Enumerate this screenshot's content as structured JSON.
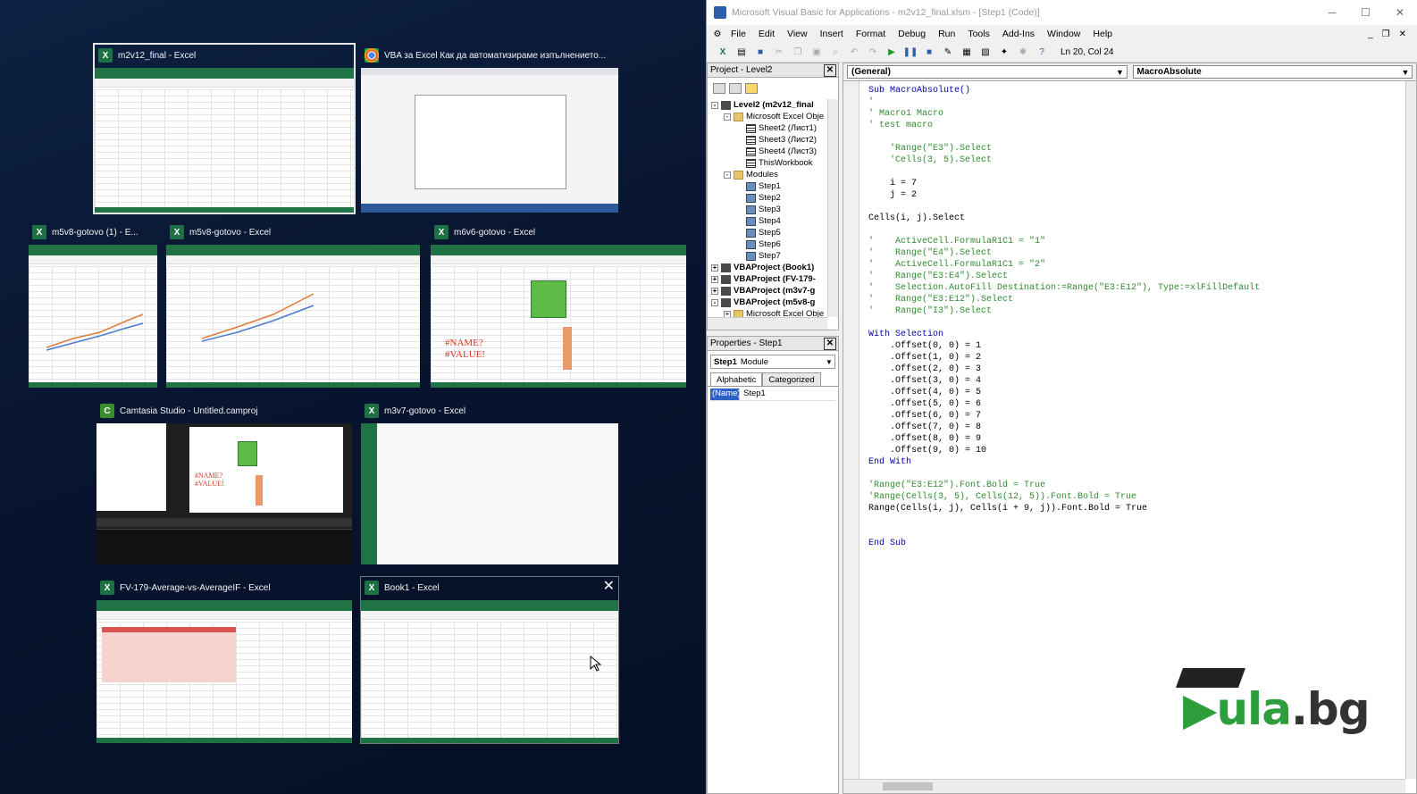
{
  "switcher": {
    "windows": [
      {
        "title": "m2v12_final - Excel",
        "icon": "excel-icon"
      },
      {
        "title": "VBA за Excel Как да автоматизираме изпълнението...",
        "icon": "chrome-icon"
      },
      {
        "title": "m5v8-gotovo (1) - E...",
        "icon": "excel-icon"
      },
      {
        "title": "m5v8-gotovo - Excel",
        "icon": "excel-icon"
      },
      {
        "title": "m6v6-gotovo - Excel",
        "icon": "excel-icon",
        "errors": [
          "#NAME?",
          "#VALUE!"
        ]
      },
      {
        "title": "Camtasia Studio - Untitled.camproj",
        "icon": "camtasia-icon",
        "errors": [
          "#NAME?",
          "#VALUE!"
        ]
      },
      {
        "title": "m3v7-gotovo - Excel",
        "icon": "excel-icon"
      },
      {
        "title": "FV-179-Average-vs-AverageIF - Excel",
        "icon": "excel-icon"
      },
      {
        "title": "Book1 - Excel",
        "icon": "excel-icon"
      }
    ]
  },
  "vbe": {
    "title": "Microsoft Visual Basic for Applications - m2v12_final.xlsm - [Step1 (Code)]",
    "menu": [
      "File",
      "Edit",
      "View",
      "Insert",
      "Format",
      "Debug",
      "Run",
      "Tools",
      "Add-Ins",
      "Window",
      "Help"
    ],
    "cursor_pos": "Ln 20, Col 24",
    "project": {
      "header": "Project - Level2",
      "tree": [
        {
          "label": "Level2 (m2v12_final",
          "level": 0,
          "kind": "proj",
          "toggle": "-",
          "bold": true
        },
        {
          "label": "Microsoft Excel Obje",
          "level": 1,
          "kind": "fold",
          "toggle": "-"
        },
        {
          "label": "Sheet2 (Лист1)",
          "level": 2,
          "kind": "sheet"
        },
        {
          "label": "Sheet3 (Лист2)",
          "level": 2,
          "kind": "sheet"
        },
        {
          "label": "Sheet4 (Лист3)",
          "level": 2,
          "kind": "sheet"
        },
        {
          "label": "ThisWorkbook",
          "level": 2,
          "kind": "sheet"
        },
        {
          "label": "Modules",
          "level": 1,
          "kind": "fold",
          "toggle": "-"
        },
        {
          "label": "Step1",
          "level": 2,
          "kind": "mod"
        },
        {
          "label": "Step2",
          "level": 2,
          "kind": "mod"
        },
        {
          "label": "Step3",
          "level": 2,
          "kind": "mod"
        },
        {
          "label": "Step4",
          "level": 2,
          "kind": "mod"
        },
        {
          "label": "Step5",
          "level": 2,
          "kind": "mod"
        },
        {
          "label": "Step6",
          "level": 2,
          "kind": "mod"
        },
        {
          "label": "Step7",
          "level": 2,
          "kind": "mod"
        },
        {
          "label": "VBAProject (Book1)",
          "level": 0,
          "kind": "proj",
          "toggle": "+",
          "bold": true
        },
        {
          "label": "VBAProject (FV-179-",
          "level": 0,
          "kind": "proj",
          "toggle": "+",
          "bold": true
        },
        {
          "label": "VBAProject (m3v7-g",
          "level": 0,
          "kind": "proj",
          "toggle": "+",
          "bold": true
        },
        {
          "label": "VBAProject (m5v8-g",
          "level": 0,
          "kind": "proj",
          "toggle": "-",
          "bold": true
        },
        {
          "label": "Microsoft Excel Obje",
          "level": 1,
          "kind": "fold",
          "toggle": "+"
        }
      ]
    },
    "properties": {
      "header": "Properties - Step1",
      "object_name": "Step1",
      "object_type": "Module",
      "tabs": [
        "Alphabetic",
        "Categorized"
      ],
      "rows": [
        {
          "key": "(Name)",
          "value": "Step1"
        }
      ]
    },
    "combo_object": "(General)",
    "combo_proc": "MacroAbsolute",
    "code_lines": [
      {
        "t": "Sub MacroAbsolute()",
        "c": "kw"
      },
      {
        "t": "'",
        "c": "cm"
      },
      {
        "t": "' Macro1 Macro",
        "c": "cm"
      },
      {
        "t": "' test macro",
        "c": "cm"
      },
      {
        "t": "",
        "c": ""
      },
      {
        "t": "    'Range(\"E3\").Select",
        "c": "cm"
      },
      {
        "t": "    'Cells(3, 5).Select",
        "c": "cm"
      },
      {
        "t": "",
        "c": ""
      },
      {
        "t": "    i = 7",
        "c": ""
      },
      {
        "t": "    j = 2",
        "c": ""
      },
      {
        "t": "",
        "c": ""
      },
      {
        "t": "Cells(i, j).Select",
        "c": ""
      },
      {
        "t": "",
        "c": ""
      },
      {
        "t": "'    ActiveCell.FormulaR1C1 = \"1\"",
        "c": "cm"
      },
      {
        "t": "'    Range(\"E4\").Select",
        "c": "cm"
      },
      {
        "t": "'    ActiveCell.FormulaR1C1 = \"2\"",
        "c": "cm"
      },
      {
        "t": "'    Range(\"E3:E4\").Select",
        "c": "cm"
      },
      {
        "t": "'    Selection.AutoFill Destination:=Range(\"E3:E12\"), Type:=xlFillDefault",
        "c": "cm"
      },
      {
        "t": "'    Range(\"E3:E12\").Select",
        "c": "cm"
      },
      {
        "t": "'    Range(\"I3\").Select",
        "c": "cm"
      },
      {
        "t": "",
        "c": ""
      },
      {
        "t": "With Selection",
        "c": "kw"
      },
      {
        "t": "    .Offset(0, 0) = 1",
        "c": ""
      },
      {
        "t": "    .Offset(1, 0) = 2",
        "c": ""
      },
      {
        "t": "    .Offset(2, 0) = 3",
        "c": ""
      },
      {
        "t": "    .Offset(3, 0) = 4",
        "c": ""
      },
      {
        "t": "    .Offset(4, 0) = 5",
        "c": ""
      },
      {
        "t": "    .Offset(5, 0) = 6",
        "c": ""
      },
      {
        "t": "    .Offset(6, 0) = 7",
        "c": ""
      },
      {
        "t": "    .Offset(7, 0) = 8",
        "c": ""
      },
      {
        "t": "    .Offset(8, 0) = 9",
        "c": ""
      },
      {
        "t": "    .Offset(9, 0) = 10",
        "c": ""
      },
      {
        "t": "End With",
        "c": "kw"
      },
      {
        "t": "",
        "c": ""
      },
      {
        "t": "'Range(\"E3:E12\").Font.Bold = True",
        "c": "cm"
      },
      {
        "t": "'Range(Cells(3, 5), Cells(12, 5)).Font.Bold = True",
        "c": "cm"
      },
      {
        "t": "Range(Cells(i, j), Cells(i + 9, j)).Font.Bold = True",
        "c": ""
      },
      {
        "t": "",
        "c": ""
      },
      {
        "t": "",
        "c": ""
      },
      {
        "t": "End Sub",
        "c": "kw"
      }
    ]
  },
  "logo": {
    "text_a": "ula",
    "text_b": ".bg"
  },
  "colors": {
    "excel_green": "#217346",
    "selection_blue": "#2c62c8",
    "comment_green": "#2e8b2e",
    "keyword_blue": "#0000b0"
  }
}
